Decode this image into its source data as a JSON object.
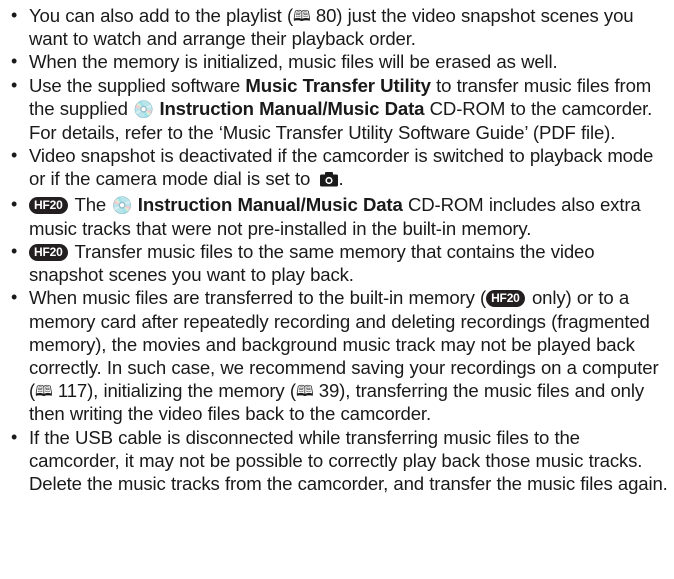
{
  "items": [
    {
      "t1": "You can also add to the playlist (",
      "book_icon": "book-icon",
      "ref": " 80)",
      "t2": " just the video snapshot scenes you want to watch and arrange their playback order."
    },
    {
      "t1": "When the memory is initialized, music files will be erased as well."
    },
    {
      "t1": "Use the supplied software ",
      "bold1": "Music Transfer Utility",
      "t2": " to transfer music files from the supplied ",
      "disc_icon": "disc-icon",
      "bold2": "Instruction Manual/Music Data",
      "t3": " CD-ROM to the camcorder. For details, refer to the ‘Music Transfer Utility Software Guide’ (PDF file)."
    },
    {
      "t1": "Video snapshot is deactivated if the camcorder is switched to playback mode or if the camera mode dial is set to ",
      "camera_icon": "camera-icon",
      "t2": "."
    },
    {
      "badge": "HF20",
      "t1": " The ",
      "disc_icon": "disc-icon",
      "bold1": "Instruction Manual/Music Data",
      "t2": " CD-ROM includes also extra music tracks that were not pre-installed in the built-in memory."
    },
    {
      "badge": "HF20",
      "t1": " Transfer music files to the same memory that contains the video snapshot scenes you want to play back."
    },
    {
      "t1": "When music files are transferred to the built-in memory (",
      "badge": "HF20",
      "t2": " only) or to a memory card after repeatedly recording and deleting recordings (fragmented memory), the movies and background music track may not be played back correctly. In such case, we recommend saving your recordings on a computer (",
      "ref1": " 117)",
      "t3": ", initializing the memory (",
      "ref2": " 39)",
      "t4": ", transferring the music files and only then writing the video files back to the camcorder."
    },
    {
      "t1": "If the USB cable is disconnected while transferring music files to the camcorder, it may not be possible to correctly play back those music tracks. Delete the music tracks from the camcorder, and transfer the music files again."
    }
  ]
}
